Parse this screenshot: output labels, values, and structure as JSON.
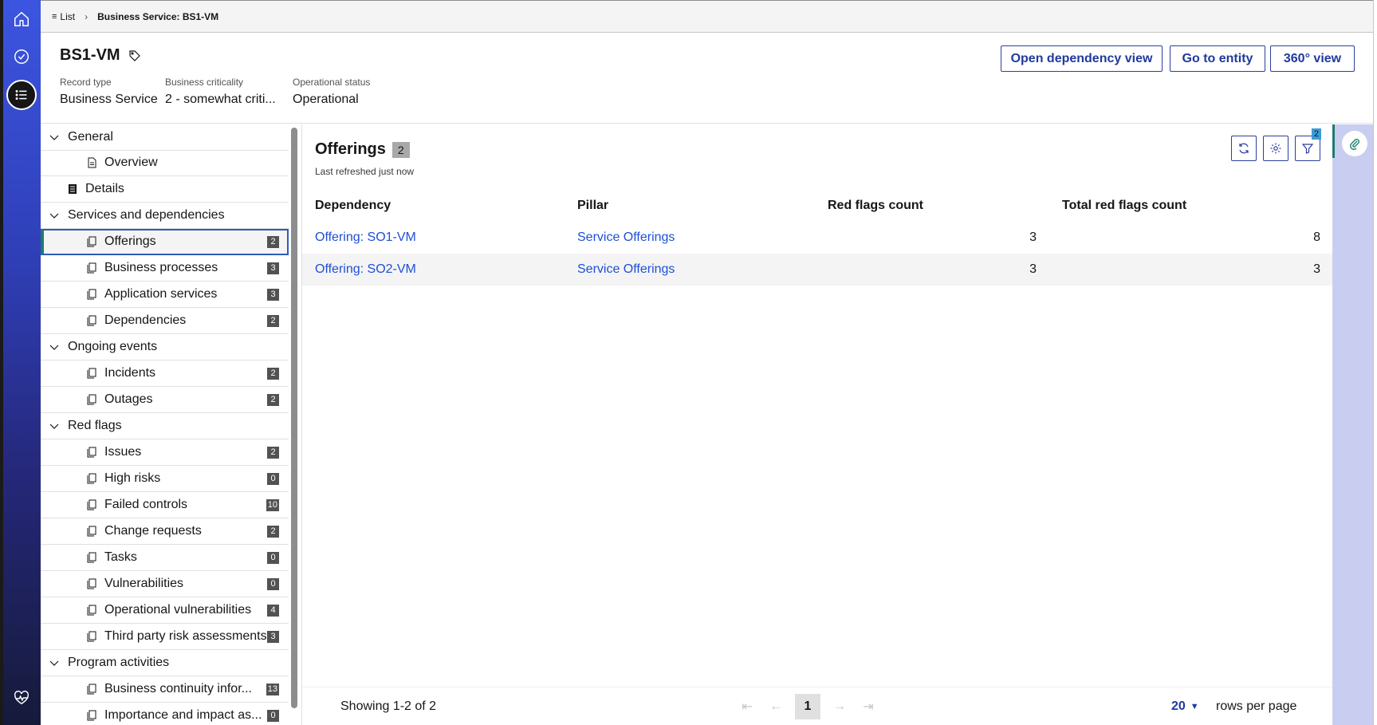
{
  "breadcrumb": {
    "list_label": "List",
    "current": "Business Service: BS1-VM"
  },
  "record": {
    "title": "BS1-VM",
    "fields": [
      {
        "label": "Record type",
        "value": "Business Service"
      },
      {
        "label": "Business criticality",
        "value": "2 - somewhat criti..."
      },
      {
        "label": "Operational status",
        "value": "Operational"
      }
    ]
  },
  "header_buttons": {
    "dependency": "Open dependency view",
    "entity": "Go to entity",
    "view360": "360° view"
  },
  "tree": {
    "general": "General",
    "overview": "Overview",
    "details": "Details",
    "services": "Services and dependencies",
    "offerings": {
      "label": "Offerings",
      "count": "2"
    },
    "business_processes": {
      "label": "Business processes",
      "count": "3"
    },
    "application_services": {
      "label": "Application services",
      "count": "3"
    },
    "dependencies": {
      "label": "Dependencies",
      "count": "2"
    },
    "ongoing": "Ongoing events",
    "incidents": {
      "label": "Incidents",
      "count": "2"
    },
    "outages": {
      "label": "Outages",
      "count": "2"
    },
    "red_flags": "Red flags",
    "issues": {
      "label": "Issues",
      "count": "2"
    },
    "high_risks": {
      "label": "High risks",
      "count": "0"
    },
    "failed_controls": {
      "label": "Failed controls",
      "count": "10"
    },
    "change_requests": {
      "label": "Change requests",
      "count": "2"
    },
    "tasks": {
      "label": "Tasks",
      "count": "0"
    },
    "vulnerabilities": {
      "label": "Vulnerabilities",
      "count": "0"
    },
    "op_vulnerabilities": {
      "label": "Operational vulnerabilities",
      "count": "4"
    },
    "third_party": {
      "label": "Third party risk assessments",
      "count": "3"
    },
    "program": "Program activities",
    "bc_info": {
      "label": "Business continuity infor...",
      "count": "13"
    },
    "importance": {
      "label": "Importance and impact as...",
      "count": "0"
    }
  },
  "main": {
    "title": "Offerings",
    "count": "2",
    "subtitle": "Last refreshed just now",
    "filter_count": "2",
    "columns": [
      "Dependency",
      "Pillar",
      "Red flags count",
      "Total red flags count"
    ],
    "rows": [
      {
        "dependency": "Offering: SO1-VM",
        "pillar": "Service Offerings",
        "red": "3",
        "total": "8"
      },
      {
        "dependency": "Offering: SO2-VM",
        "pillar": "Service Offerings",
        "red": "3",
        "total": "3"
      }
    ]
  },
  "pager": {
    "showing": "Showing 1-2 of 2",
    "page": "1",
    "page_size": "20",
    "rows_per_page": "rows per page"
  }
}
